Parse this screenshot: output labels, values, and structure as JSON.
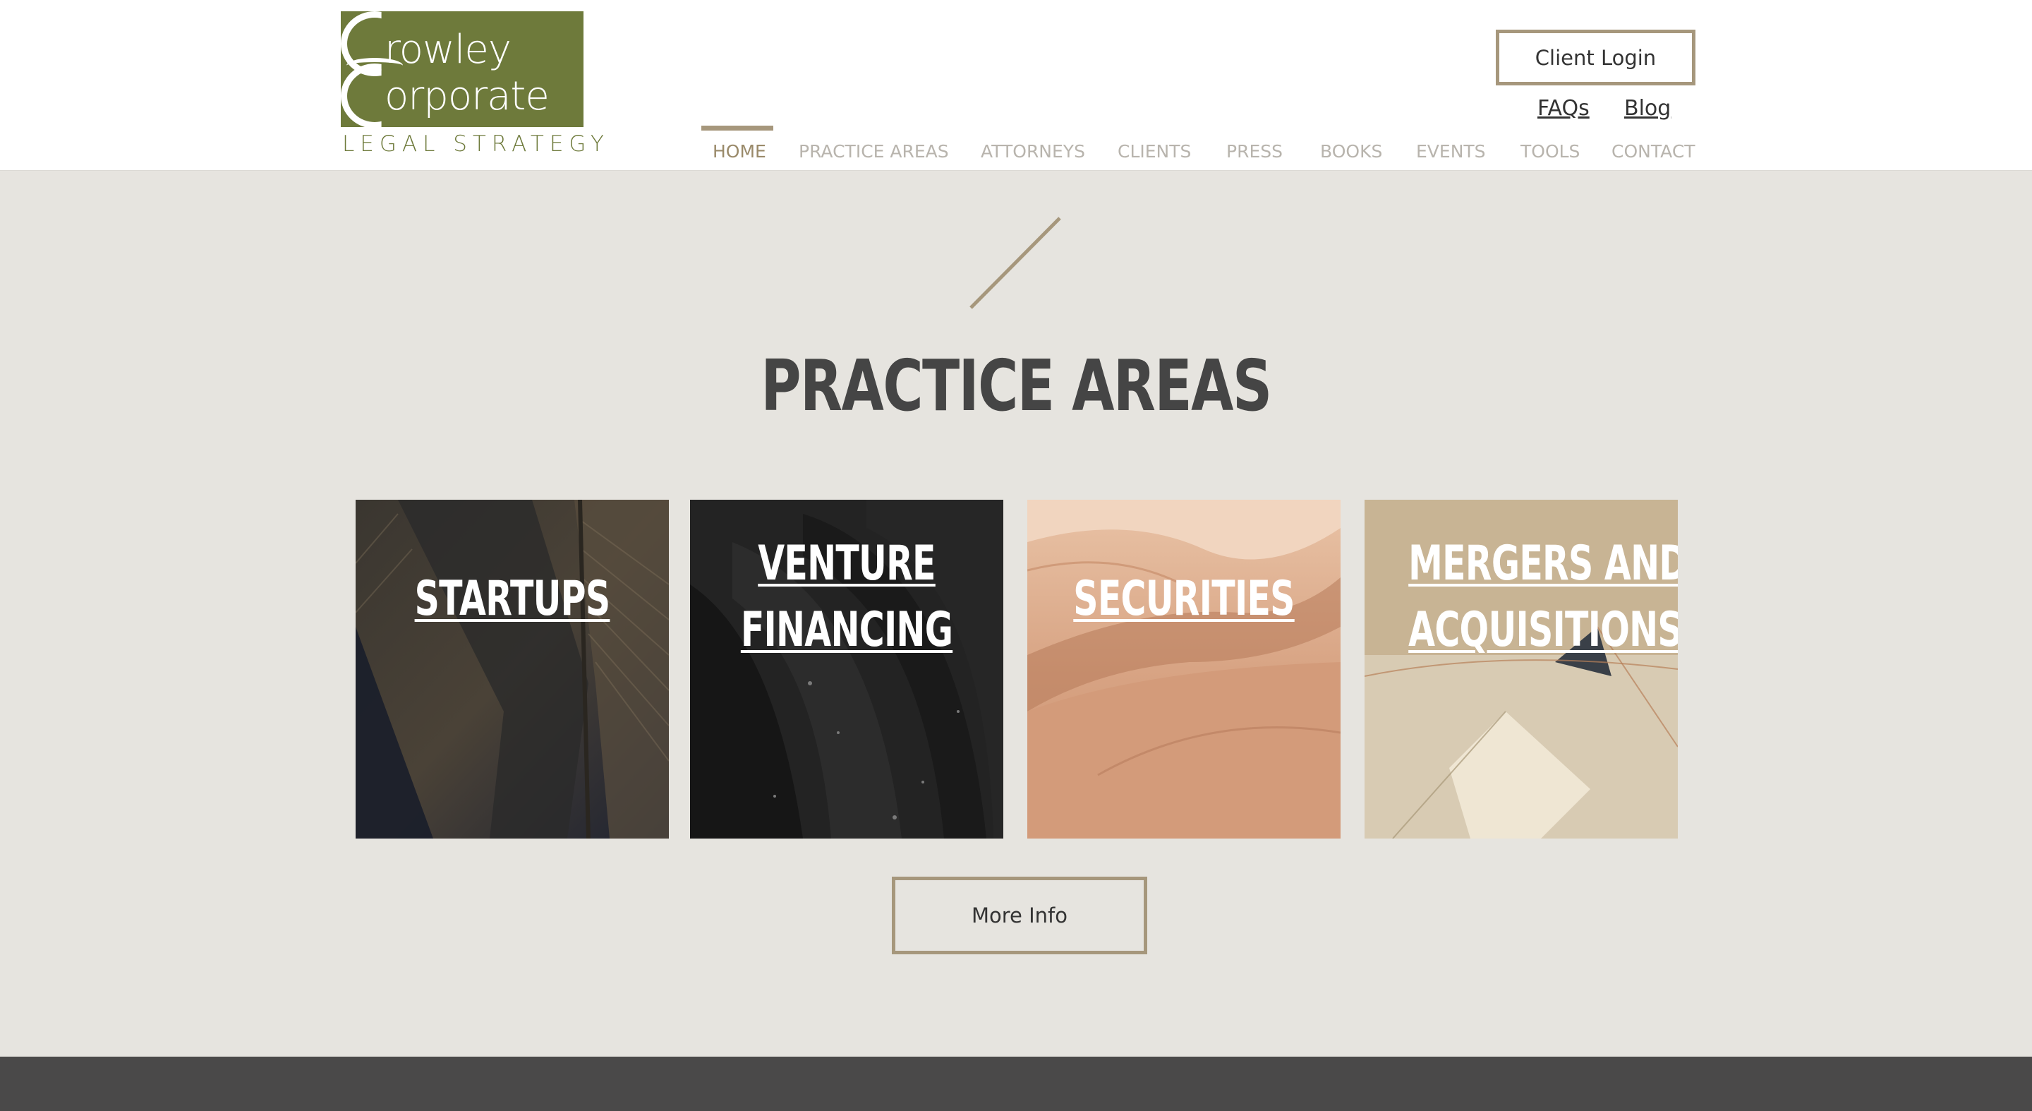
{
  "header": {
    "logo": {
      "line1": "rowley",
      "line2": "orporate",
      "tagline": "LEGAL STRATEGY",
      "brand_color": "#6e7a3b"
    },
    "client_login_label": "Client Login",
    "faqs_label": "FAQs",
    "blog_label": "Blog"
  },
  "nav": {
    "items": [
      {
        "label": "HOME",
        "active": true
      },
      {
        "label": "PRACTICE AREAS",
        "active": false
      },
      {
        "label": "ATTORNEYS",
        "active": false
      },
      {
        "label": "CLIENTS",
        "active": false
      },
      {
        "label": "PRESS",
        "active": false
      },
      {
        "label": "BOOKS",
        "active": false
      },
      {
        "label": "EVENTS",
        "active": false
      },
      {
        "label": "TOOLS",
        "active": false
      },
      {
        "label": "CONTACT",
        "active": false
      }
    ],
    "accent_color": "#a6977c"
  },
  "main": {
    "title": "PRACTICE AREAS",
    "cards": [
      {
        "line1": "STARTUPS",
        "line2": ""
      },
      {
        "line1": "VENTURE",
        "line2": "FINANCING"
      },
      {
        "line1": "SECURITIES",
        "line2": ""
      },
      {
        "line1": "MERGERS AND",
        "line2": "ACQUISITIONS"
      }
    ],
    "more_info_label": "More Info"
  }
}
